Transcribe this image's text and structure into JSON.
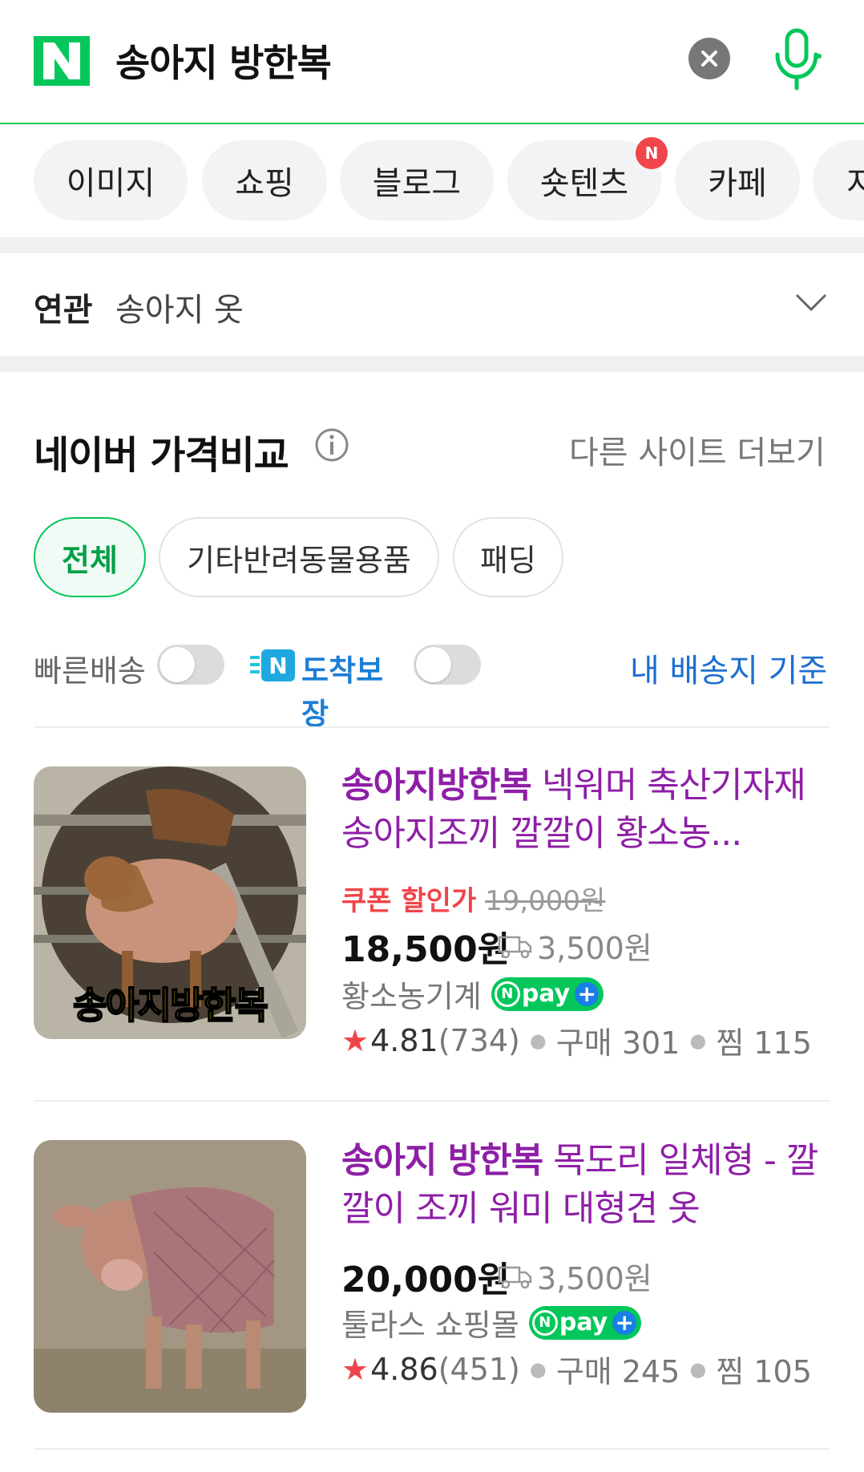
{
  "search": {
    "query": "송아지 방한복",
    "logo": "N",
    "clear_icon": "close-icon",
    "mic_icon": "microphone-icon",
    "accent": "#03c75a"
  },
  "tabs": [
    {
      "label": "이미지"
    },
    {
      "label": "쇼핑"
    },
    {
      "label": "블로그"
    },
    {
      "label": "숏텐츠",
      "badge": "N"
    },
    {
      "label": "카페"
    },
    {
      "label": "지"
    }
  ],
  "related": {
    "label": "연관",
    "value": "송아지 옷"
  },
  "price_compare": {
    "title": "네이버 가격비교",
    "more": "다른 사이트 더보기",
    "chips": [
      "전체",
      "기타반려동물용품",
      "패딩"
    ],
    "filters": {
      "fast_delivery": "빠른배송",
      "arrival_badge": "N",
      "arrival_guarantee": "도착보장",
      "address": "내 배송지 기준"
    }
  },
  "products": [
    {
      "thumb_caption": "송아지방한복",
      "title_highlight": "송아지방한복",
      "title_rest": " 넥워머 축산기자재 송아지조끼 깔깔이 황소농...",
      "coupon_label": "쿠폰 할인가",
      "original_price": "19,000원",
      "price": "18,500원",
      "shipping": "3,500원",
      "store": "황소농기계",
      "npay": "pay",
      "rating": "4.81",
      "reviews": "(734)",
      "purchases": "구매 301",
      "wishes": "찜 115"
    },
    {
      "title_highlight": "송아지 방한복",
      "title_rest": " 목도리 일체형 - 깔깔이 조끼 워미 대형견 옷",
      "price": "20,000원",
      "shipping": "3,500원",
      "store": "툴라스 쇼핑몰",
      "npay": "pay",
      "rating": "4.86",
      "reviews": "(451)",
      "purchases": "구매 245",
      "wishes": "찜 105"
    }
  ]
}
